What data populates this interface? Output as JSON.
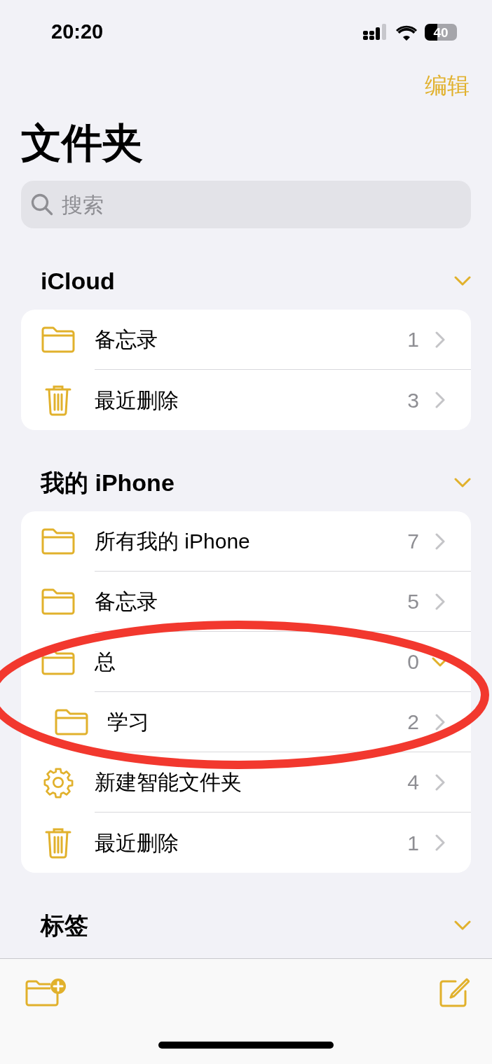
{
  "status_bar": {
    "time": "20:20",
    "battery": "40"
  },
  "nav": {
    "edit": "编辑",
    "title": "文件夹"
  },
  "search": {
    "placeholder": "搜索"
  },
  "sections": [
    {
      "title": "iCloud",
      "expanded": true,
      "rows": [
        {
          "kind": "folder",
          "label": "备忘录",
          "count": "1",
          "expanded": false
        },
        {
          "kind": "trash",
          "label": "最近删除",
          "count": "3",
          "expanded": false
        }
      ]
    },
    {
      "title": "我的 iPhone",
      "expanded": true,
      "rows": [
        {
          "kind": "folder",
          "label": "所有我的 iPhone",
          "count": "7",
          "expanded": false
        },
        {
          "kind": "folder",
          "label": "备忘录",
          "count": "5",
          "expanded": false
        },
        {
          "kind": "folder",
          "label": "总",
          "count": "0",
          "expanded": true,
          "children": [
            {
              "kind": "folder",
              "label": "学习",
              "count": "2",
              "expanded": false
            }
          ]
        },
        {
          "kind": "gear",
          "label": "新建智能文件夹",
          "count": "4",
          "expanded": false
        },
        {
          "kind": "trash",
          "label": "最近删除",
          "count": "1",
          "expanded": false
        }
      ]
    },
    {
      "title": "标签",
      "expanded": true
    }
  ]
}
